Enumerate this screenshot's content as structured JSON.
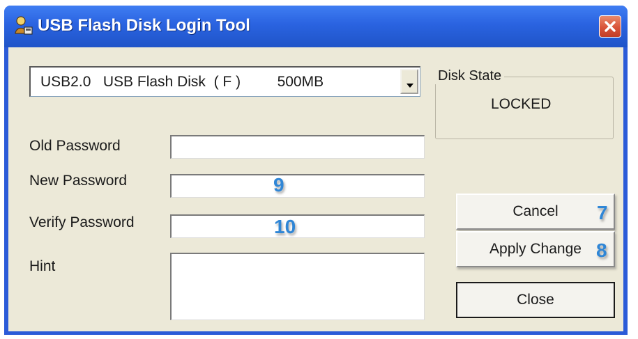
{
  "window": {
    "title": "USB Flash Disk Login Tool",
    "icon": "usb-user-icon",
    "close_icon": "close-icon"
  },
  "device": {
    "selected": "USB2.0   USB Flash Disk  ( F )         500MB"
  },
  "disk_state": {
    "label": "Disk State",
    "value": "LOCKED"
  },
  "fields": {
    "old_password": {
      "label": "Old Password",
      "value": ""
    },
    "new_password": {
      "label": "New Password",
      "value": ""
    },
    "verify_password": {
      "label": "Verify Password",
      "value": ""
    },
    "hint": {
      "label": "Hint",
      "value": ""
    }
  },
  "buttons": {
    "cancel": "Cancel",
    "apply_change": "Apply Change",
    "close": "Close"
  },
  "annotations": {
    "new_password": "9",
    "verify_password": "10",
    "cancel": "7",
    "apply_change": "8"
  },
  "colors": {
    "titlebar": "#2a63e0",
    "dialog_background": "#ece9d8",
    "annotation": "#2f86d6",
    "close_button": "#d9543a"
  }
}
